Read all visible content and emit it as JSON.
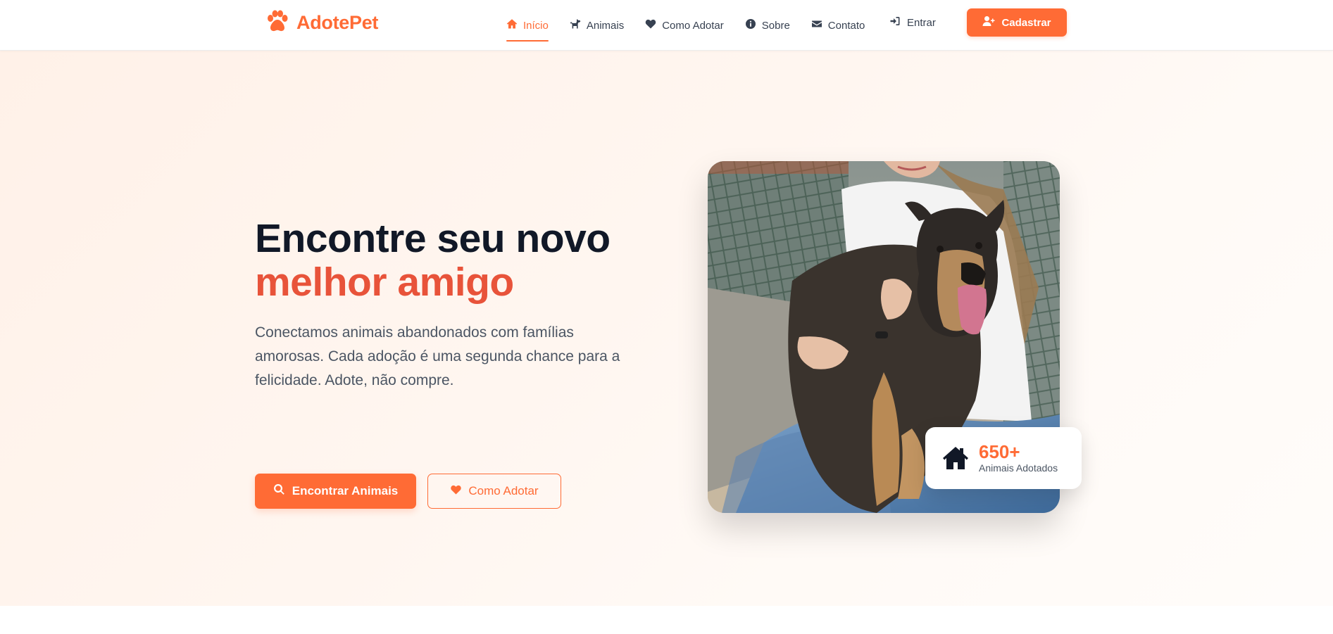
{
  "brand": {
    "name": "AdotePet",
    "icon": "paw-icon",
    "color": "#ff6b35"
  },
  "nav": {
    "items": [
      {
        "label": "Início",
        "icon": "home-icon",
        "active": true
      },
      {
        "label": "Animais",
        "icon": "dog-icon",
        "active": false
      },
      {
        "label": "Como Adotar",
        "icon": "heart-icon",
        "active": false
      },
      {
        "label": "Sobre",
        "icon": "info-circle-icon",
        "active": false
      },
      {
        "label": "Contato",
        "icon": "envelope-icon",
        "active": false
      }
    ],
    "login_label": "Entrar",
    "signup_label": "Cadastrar"
  },
  "hero": {
    "title_line1": "Encontre seu novo",
    "title_line2": "melhor amigo",
    "subtitle": "Conectamos animais abandonados com famílias amorosas. Cada adoção é uma segunda chance para a felicidade. Adote, não compre.",
    "primary_button": "Encontrar Animais",
    "secondary_button": "Como Adotar",
    "image_alt": "Mulher abraçando cachorro",
    "stat": {
      "value": "650+",
      "label": "Animais Adotados",
      "icon": "house-icon"
    }
  },
  "colors": {
    "accent": "#ff6b35",
    "title_accent": "#e8533a",
    "heading": "#111827",
    "text": "#4b5563"
  }
}
